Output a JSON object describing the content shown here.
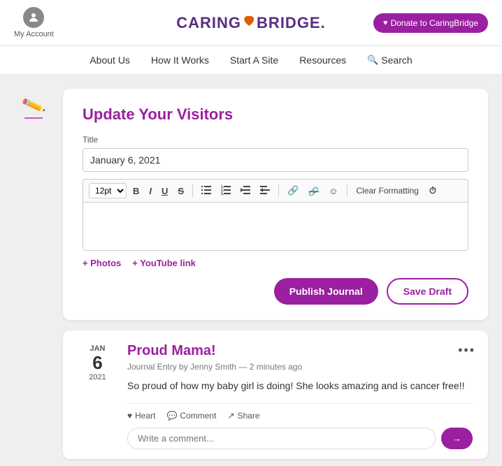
{
  "header": {
    "account_label": "My Account",
    "logo_text_before": "CARING",
    "logo_text_after": "BRIDGE.",
    "donate_btn": "Donate to CaringBridge"
  },
  "nav": {
    "items": [
      {
        "label": "About Us",
        "id": "about-us"
      },
      {
        "label": "How It Works",
        "id": "how-it-works"
      },
      {
        "label": "Start A Site",
        "id": "start-a-site"
      },
      {
        "label": "Resources",
        "id": "resources"
      },
      {
        "label": "Search",
        "id": "search"
      }
    ]
  },
  "editor": {
    "heading": "Update Your Visitors",
    "title_label": "Title",
    "title_value": "January 6, 2021",
    "toolbar": {
      "font_size": "12pt",
      "bold": "B",
      "italic": "I",
      "underline": "U",
      "strikethrough": "S",
      "unordered_list": "☰",
      "ordered_list": "☰",
      "outdent": "⇤",
      "indent": "⇥",
      "link": "🔗",
      "unlink": "🔗",
      "emoji": "☺",
      "clear_formatting": "Clear Formatting",
      "clock": "⏰"
    },
    "add_photos_label": "+ Photos",
    "add_youtube_label": "+ YouTube link",
    "publish_btn": "Publish Journal",
    "save_draft_btn": "Save Draft"
  },
  "post": {
    "date_month": "JAN",
    "date_day": "6",
    "date_year": "2021",
    "title": "Proud Mama!",
    "meta": "Journal Entry by Jenny Smith — 2 minutes ago",
    "body": "So proud of how my baby girl is doing! She looks amazing and is cancer free!!",
    "actions": {
      "heart": "Heart",
      "comment": "Comment",
      "share": "Share"
    },
    "comment_placeholder": "Write a comment...",
    "comment_submit": "→"
  }
}
